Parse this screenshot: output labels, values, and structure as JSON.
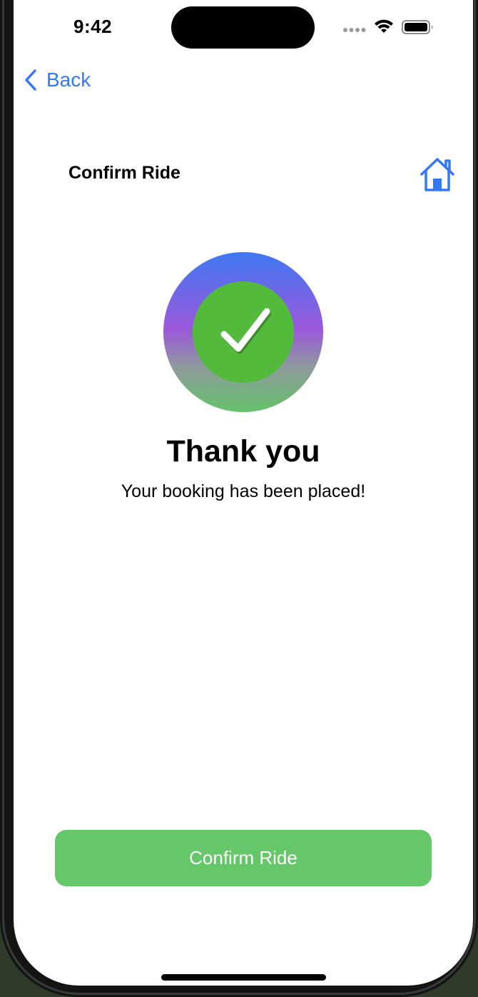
{
  "status_bar": {
    "time": "9:42",
    "icons": [
      "signal-icon",
      "wifi-icon",
      "battery-icon"
    ]
  },
  "nav": {
    "back_label": "Back",
    "back_icon": "chevron-left-icon"
  },
  "header": {
    "title": "Confirm Ride",
    "home_icon": "house-icon"
  },
  "success": {
    "icon": "checkmark-icon",
    "heading": "Thank you",
    "message": "Your booking has been placed!"
  },
  "footer": {
    "confirm_label": "Confirm Ride"
  },
  "colors": {
    "accent": "#3478f6",
    "button_green": "#66c66a",
    "check_green": "#54ba3c",
    "gradient_top": "#3f78f2",
    "gradient_mid": "#9b58dc",
    "gradient_bottom": "#66c26a"
  }
}
